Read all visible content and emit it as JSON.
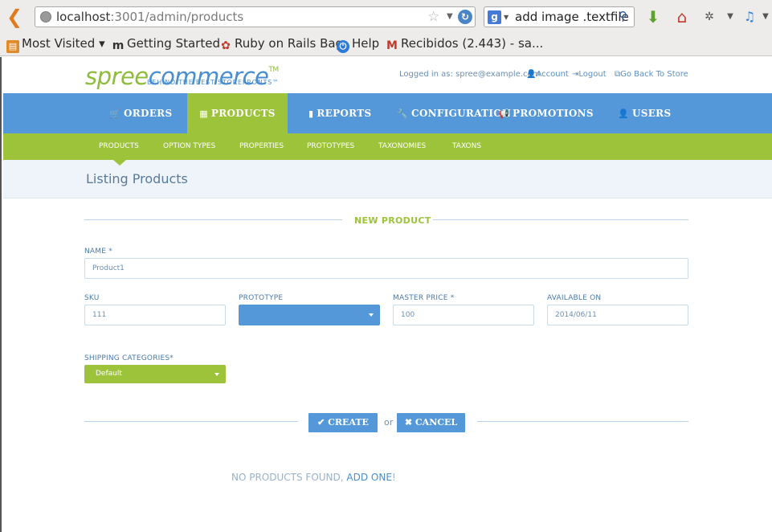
{
  "browser": {
    "url_host": "localhost",
    "url_rest": ":3001/admin/products",
    "search_text": "add image .textfile",
    "bookmarks": [
      {
        "label": "Most Visited ▾"
      },
      {
        "label": "Getting Started"
      },
      {
        "label": "Ruby on Rails Bag"
      },
      {
        "label": "Help"
      },
      {
        "label": "Recibidos (2.443) - sa..."
      }
    ]
  },
  "header": {
    "logo_spree": "spree",
    "logo_commerce": "commerce",
    "logo_tm": "TM",
    "logo_tagline": "BEHIND THE BEST STOREFRONTS™",
    "logged_in": "Logged in as: spree@example.com",
    "account": "Account",
    "logout": "Logout",
    "back_to_store": "Go Back To Store"
  },
  "main_nav": [
    {
      "label": "ORDERS",
      "icon": "cart-icon"
    },
    {
      "label": "PRODUCTS",
      "icon": "th-large-icon"
    },
    {
      "label": "REPORTS",
      "icon": "file-icon"
    },
    {
      "label": "CONFIGURATION",
      "icon": "wrench-icon"
    },
    {
      "label": "PROMOTIONS",
      "icon": "bullhorn-icon"
    },
    {
      "label": "USERS",
      "icon": "user-icon"
    }
  ],
  "sub_nav": [
    "PRODUCTS",
    "OPTION TYPES",
    "PROPERTIES",
    "PROTOTYPES",
    "TAXONOMIES",
    "TAXONS"
  ],
  "page_title": "Listing Products",
  "form": {
    "section_title": "NEW PRODUCT",
    "name_label": "NAME",
    "name_value": "Product1",
    "sku_label": "SKU",
    "sku_value": "111",
    "prototype_label": "PROTOTYPE",
    "prototype_value": "",
    "price_label": "MASTER PRICE",
    "price_value": "100",
    "available_label": "AVAILABLE ON",
    "available_value": "2014/06/11",
    "shipping_label": "SHIPPING CATEGORIES*",
    "shipping_value": "Default",
    "required_mark": "*",
    "create_label": "✔ CREATE",
    "or_label": "or",
    "cancel_label": "✖ CANCEL"
  },
  "empty": {
    "text": "NO PRODUCTS FOUND, ",
    "link": "ADD ONE",
    "tail": "!"
  },
  "colors": {
    "blue": "#5498da",
    "green": "#9dc33b"
  }
}
